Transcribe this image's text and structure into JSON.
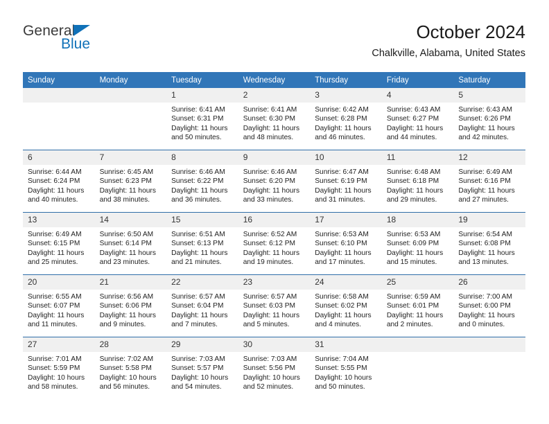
{
  "logo": {
    "text_primary": "General",
    "text_secondary": "Blue",
    "color_primary": "#3a3a3a",
    "color_secondary": "#1071b8"
  },
  "header": {
    "title": "October 2024",
    "subtitle": "Chalkville, Alabama, United States"
  },
  "theme": {
    "header_blue": "#3176b8",
    "separator_blue": "#2e6da8",
    "daynum_band": "#f0f0f0",
    "page_background": "#ffffff"
  },
  "weekday_headers": [
    "Sunday",
    "Monday",
    "Tuesday",
    "Wednesday",
    "Thursday",
    "Friday",
    "Saturday"
  ],
  "labels": {
    "sunrise_prefix": "Sunrise:",
    "sunset_prefix": "Sunset:",
    "daylight_prefix": "Daylight:"
  },
  "weeks": [
    [
      {
        "day": "",
        "blank": true,
        "sunrise": "",
        "sunset": "",
        "daylight_line1": "",
        "daylight_line2": ""
      },
      {
        "day": "",
        "blank": true,
        "sunrise": "",
        "sunset": "",
        "daylight_line1": "",
        "daylight_line2": ""
      },
      {
        "day": "1",
        "blank": false,
        "sunrise": "Sunrise: 6:41 AM",
        "sunset": "Sunset: 6:31 PM",
        "daylight_line1": "Daylight: 11 hours",
        "daylight_line2": "and 50 minutes."
      },
      {
        "day": "2",
        "blank": false,
        "sunrise": "Sunrise: 6:41 AM",
        "sunset": "Sunset: 6:30 PM",
        "daylight_line1": "Daylight: 11 hours",
        "daylight_line2": "and 48 minutes."
      },
      {
        "day": "3",
        "blank": false,
        "sunrise": "Sunrise: 6:42 AM",
        "sunset": "Sunset: 6:28 PM",
        "daylight_line1": "Daylight: 11 hours",
        "daylight_line2": "and 46 minutes."
      },
      {
        "day": "4",
        "blank": false,
        "sunrise": "Sunrise: 6:43 AM",
        "sunset": "Sunset: 6:27 PM",
        "daylight_line1": "Daylight: 11 hours",
        "daylight_line2": "and 44 minutes."
      },
      {
        "day": "5",
        "blank": false,
        "sunrise": "Sunrise: 6:43 AM",
        "sunset": "Sunset: 6:26 PM",
        "daylight_line1": "Daylight: 11 hours",
        "daylight_line2": "and 42 minutes."
      }
    ],
    [
      {
        "day": "6",
        "blank": false,
        "sunrise": "Sunrise: 6:44 AM",
        "sunset": "Sunset: 6:24 PM",
        "daylight_line1": "Daylight: 11 hours",
        "daylight_line2": "and 40 minutes."
      },
      {
        "day": "7",
        "blank": false,
        "sunrise": "Sunrise: 6:45 AM",
        "sunset": "Sunset: 6:23 PM",
        "daylight_line1": "Daylight: 11 hours",
        "daylight_line2": "and 38 minutes."
      },
      {
        "day": "8",
        "blank": false,
        "sunrise": "Sunrise: 6:46 AM",
        "sunset": "Sunset: 6:22 PM",
        "daylight_line1": "Daylight: 11 hours",
        "daylight_line2": "and 36 minutes."
      },
      {
        "day": "9",
        "blank": false,
        "sunrise": "Sunrise: 6:46 AM",
        "sunset": "Sunset: 6:20 PM",
        "daylight_line1": "Daylight: 11 hours",
        "daylight_line2": "and 33 minutes."
      },
      {
        "day": "10",
        "blank": false,
        "sunrise": "Sunrise: 6:47 AM",
        "sunset": "Sunset: 6:19 PM",
        "daylight_line1": "Daylight: 11 hours",
        "daylight_line2": "and 31 minutes."
      },
      {
        "day": "11",
        "blank": false,
        "sunrise": "Sunrise: 6:48 AM",
        "sunset": "Sunset: 6:18 PM",
        "daylight_line1": "Daylight: 11 hours",
        "daylight_line2": "and 29 minutes."
      },
      {
        "day": "12",
        "blank": false,
        "sunrise": "Sunrise: 6:49 AM",
        "sunset": "Sunset: 6:16 PM",
        "daylight_line1": "Daylight: 11 hours",
        "daylight_line2": "and 27 minutes."
      }
    ],
    [
      {
        "day": "13",
        "blank": false,
        "sunrise": "Sunrise: 6:49 AM",
        "sunset": "Sunset: 6:15 PM",
        "daylight_line1": "Daylight: 11 hours",
        "daylight_line2": "and 25 minutes."
      },
      {
        "day": "14",
        "blank": false,
        "sunrise": "Sunrise: 6:50 AM",
        "sunset": "Sunset: 6:14 PM",
        "daylight_line1": "Daylight: 11 hours",
        "daylight_line2": "and 23 minutes."
      },
      {
        "day": "15",
        "blank": false,
        "sunrise": "Sunrise: 6:51 AM",
        "sunset": "Sunset: 6:13 PM",
        "daylight_line1": "Daylight: 11 hours",
        "daylight_line2": "and 21 minutes."
      },
      {
        "day": "16",
        "blank": false,
        "sunrise": "Sunrise: 6:52 AM",
        "sunset": "Sunset: 6:12 PM",
        "daylight_line1": "Daylight: 11 hours",
        "daylight_line2": "and 19 minutes."
      },
      {
        "day": "17",
        "blank": false,
        "sunrise": "Sunrise: 6:53 AM",
        "sunset": "Sunset: 6:10 PM",
        "daylight_line1": "Daylight: 11 hours",
        "daylight_line2": "and 17 minutes."
      },
      {
        "day": "18",
        "blank": false,
        "sunrise": "Sunrise: 6:53 AM",
        "sunset": "Sunset: 6:09 PM",
        "daylight_line1": "Daylight: 11 hours",
        "daylight_line2": "and 15 minutes."
      },
      {
        "day": "19",
        "blank": false,
        "sunrise": "Sunrise: 6:54 AM",
        "sunset": "Sunset: 6:08 PM",
        "daylight_line1": "Daylight: 11 hours",
        "daylight_line2": "and 13 minutes."
      }
    ],
    [
      {
        "day": "20",
        "blank": false,
        "sunrise": "Sunrise: 6:55 AM",
        "sunset": "Sunset: 6:07 PM",
        "daylight_line1": "Daylight: 11 hours",
        "daylight_line2": "and 11 minutes."
      },
      {
        "day": "21",
        "blank": false,
        "sunrise": "Sunrise: 6:56 AM",
        "sunset": "Sunset: 6:06 PM",
        "daylight_line1": "Daylight: 11 hours",
        "daylight_line2": "and 9 minutes."
      },
      {
        "day": "22",
        "blank": false,
        "sunrise": "Sunrise: 6:57 AM",
        "sunset": "Sunset: 6:04 PM",
        "daylight_line1": "Daylight: 11 hours",
        "daylight_line2": "and 7 minutes."
      },
      {
        "day": "23",
        "blank": false,
        "sunrise": "Sunrise: 6:57 AM",
        "sunset": "Sunset: 6:03 PM",
        "daylight_line1": "Daylight: 11 hours",
        "daylight_line2": "and 5 minutes."
      },
      {
        "day": "24",
        "blank": false,
        "sunrise": "Sunrise: 6:58 AM",
        "sunset": "Sunset: 6:02 PM",
        "daylight_line1": "Daylight: 11 hours",
        "daylight_line2": "and 4 minutes."
      },
      {
        "day": "25",
        "blank": false,
        "sunrise": "Sunrise: 6:59 AM",
        "sunset": "Sunset: 6:01 PM",
        "daylight_line1": "Daylight: 11 hours",
        "daylight_line2": "and 2 minutes."
      },
      {
        "day": "26",
        "blank": false,
        "sunrise": "Sunrise: 7:00 AM",
        "sunset": "Sunset: 6:00 PM",
        "daylight_line1": "Daylight: 11 hours",
        "daylight_line2": "and 0 minutes."
      }
    ],
    [
      {
        "day": "27",
        "blank": false,
        "sunrise": "Sunrise: 7:01 AM",
        "sunset": "Sunset: 5:59 PM",
        "daylight_line1": "Daylight: 10 hours",
        "daylight_line2": "and 58 minutes."
      },
      {
        "day": "28",
        "blank": false,
        "sunrise": "Sunrise: 7:02 AM",
        "sunset": "Sunset: 5:58 PM",
        "daylight_line1": "Daylight: 10 hours",
        "daylight_line2": "and 56 minutes."
      },
      {
        "day": "29",
        "blank": false,
        "sunrise": "Sunrise: 7:03 AM",
        "sunset": "Sunset: 5:57 PM",
        "daylight_line1": "Daylight: 10 hours",
        "daylight_line2": "and 54 minutes."
      },
      {
        "day": "30",
        "blank": false,
        "sunrise": "Sunrise: 7:03 AM",
        "sunset": "Sunset: 5:56 PM",
        "daylight_line1": "Daylight: 10 hours",
        "daylight_line2": "and 52 minutes."
      },
      {
        "day": "31",
        "blank": false,
        "sunrise": "Sunrise: 7:04 AM",
        "sunset": "Sunset: 5:55 PM",
        "daylight_line1": "Daylight: 10 hours",
        "daylight_line2": "and 50 minutes."
      },
      {
        "day": "",
        "blank": true,
        "sunrise": "",
        "sunset": "",
        "daylight_line1": "",
        "daylight_line2": ""
      },
      {
        "day": "",
        "blank": true,
        "sunrise": "",
        "sunset": "",
        "daylight_line1": "",
        "daylight_line2": ""
      }
    ]
  ]
}
